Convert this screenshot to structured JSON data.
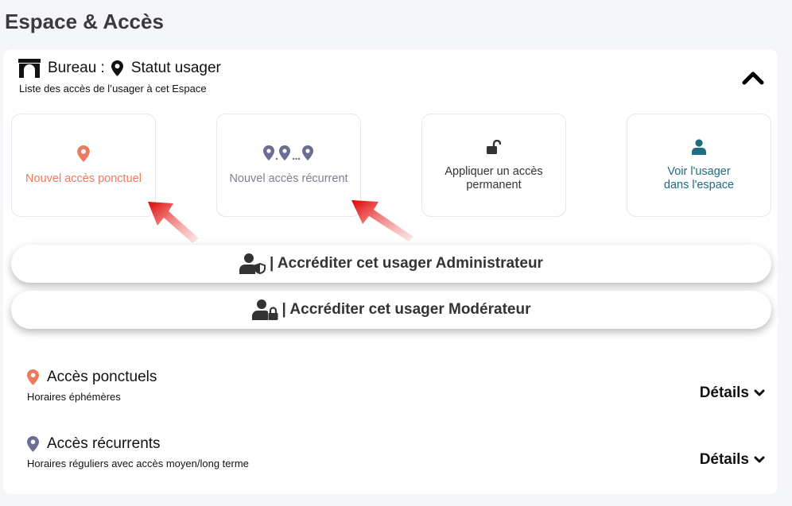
{
  "page": {
    "title": "Espace & Accès"
  },
  "card": {
    "header": {
      "bureau_label": "Bureau :",
      "status_label": "Statut usager",
      "subtitle": "Liste des accès de l’usager à cet Espace"
    },
    "tiles": [
      {
        "label": "Nouvel accès ponctuel",
        "icon": "map-pin-icon",
        "color": "#ec7a5e"
      },
      {
        "label": "Nouvel accès récurrent",
        "icon": "multi-pin-icon",
        "color": "#7d7f92"
      },
      {
        "label_line1": "Appliquer un accès",
        "label_line2": "permanent",
        "icon": "unlock-icon",
        "color": "#333333"
      },
      {
        "label_line1": "Voir l'usager",
        "label_line2": "dans l'espace",
        "icon": "user-icon",
        "color": "#1d6c80"
      }
    ],
    "accreditation": {
      "admin_label": "| Accréditer cet usager Administrateur",
      "mod_label": "| Accréditer cet usager Modérateur"
    },
    "sections": [
      {
        "title": "Accès ponctuels",
        "subtitle": "Horaires éphémères",
        "details": "Détails",
        "color": "#ec7a5e"
      },
      {
        "title": "Accès récurrents",
        "subtitle": "Horaires réguliers avec accès moyen/long terme",
        "details": "Détails",
        "color": "#6b6d92"
      }
    ]
  }
}
